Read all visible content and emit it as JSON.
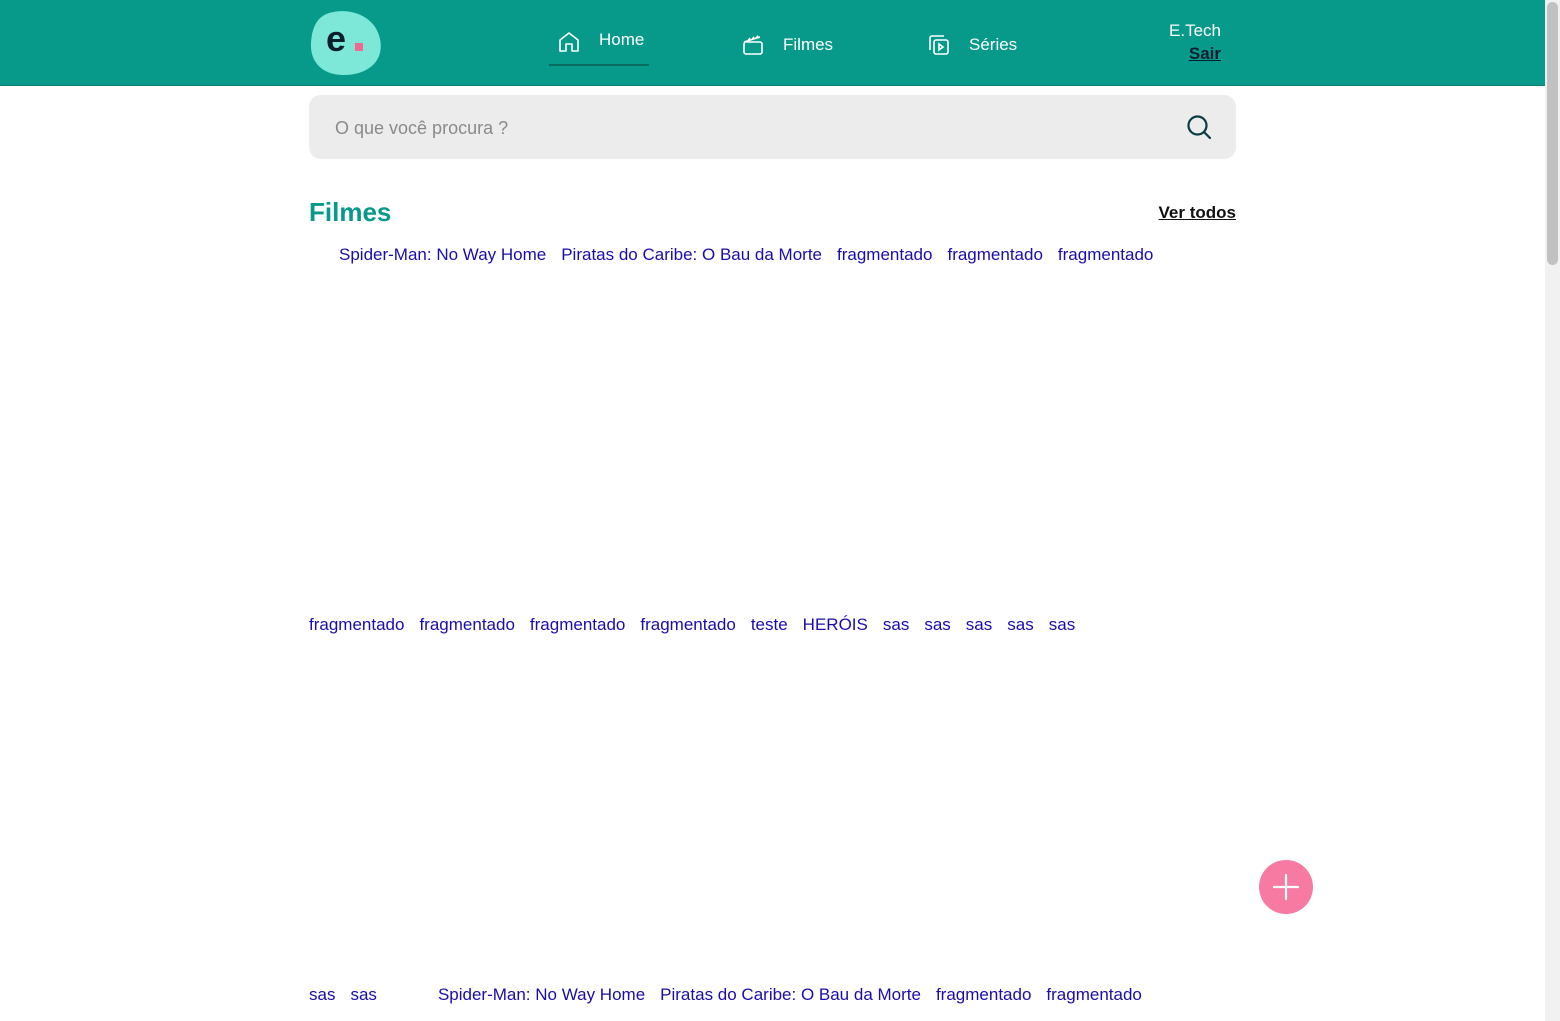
{
  "header": {
    "logo_letter": "e",
    "nav": [
      {
        "label": "Home",
        "icon": "home-icon"
      },
      {
        "label": "Filmes",
        "icon": "clapperboard-icon"
      },
      {
        "label": "Séries",
        "icon": "play-stack-icon"
      }
    ],
    "user_name": "E.Tech",
    "logout_label": "Sair"
  },
  "search": {
    "placeholder": "O que você procura ?",
    "icon": "search-icon"
  },
  "section": {
    "title": "Filmes",
    "see_all_label": "Ver todos"
  },
  "movies_row1": [
    "Spider-Man: No Way Home",
    "Piratas do Caribe: O Bau da Morte",
    "fragmentado",
    "fragmentado",
    "fragmentado"
  ],
  "movies_row2": [
    "fragmentado",
    "fragmentado",
    "fragmentado",
    "fragmentado",
    "teste",
    "HERÓIS",
    "sas",
    "sas",
    "sas",
    "sas",
    "sas"
  ],
  "movies_row3": [
    "sas",
    "sas",
    "Spider-Man: No Way Home",
    "Piratas do Caribe: O Bau da Morte",
    "fragmentado",
    "fragmentado"
  ],
  "fab": {
    "icon": "plus-icon"
  },
  "colors": {
    "primary": "#07998a",
    "accent": "#f67aa1",
    "logo_bg": "#7ee8d8"
  }
}
